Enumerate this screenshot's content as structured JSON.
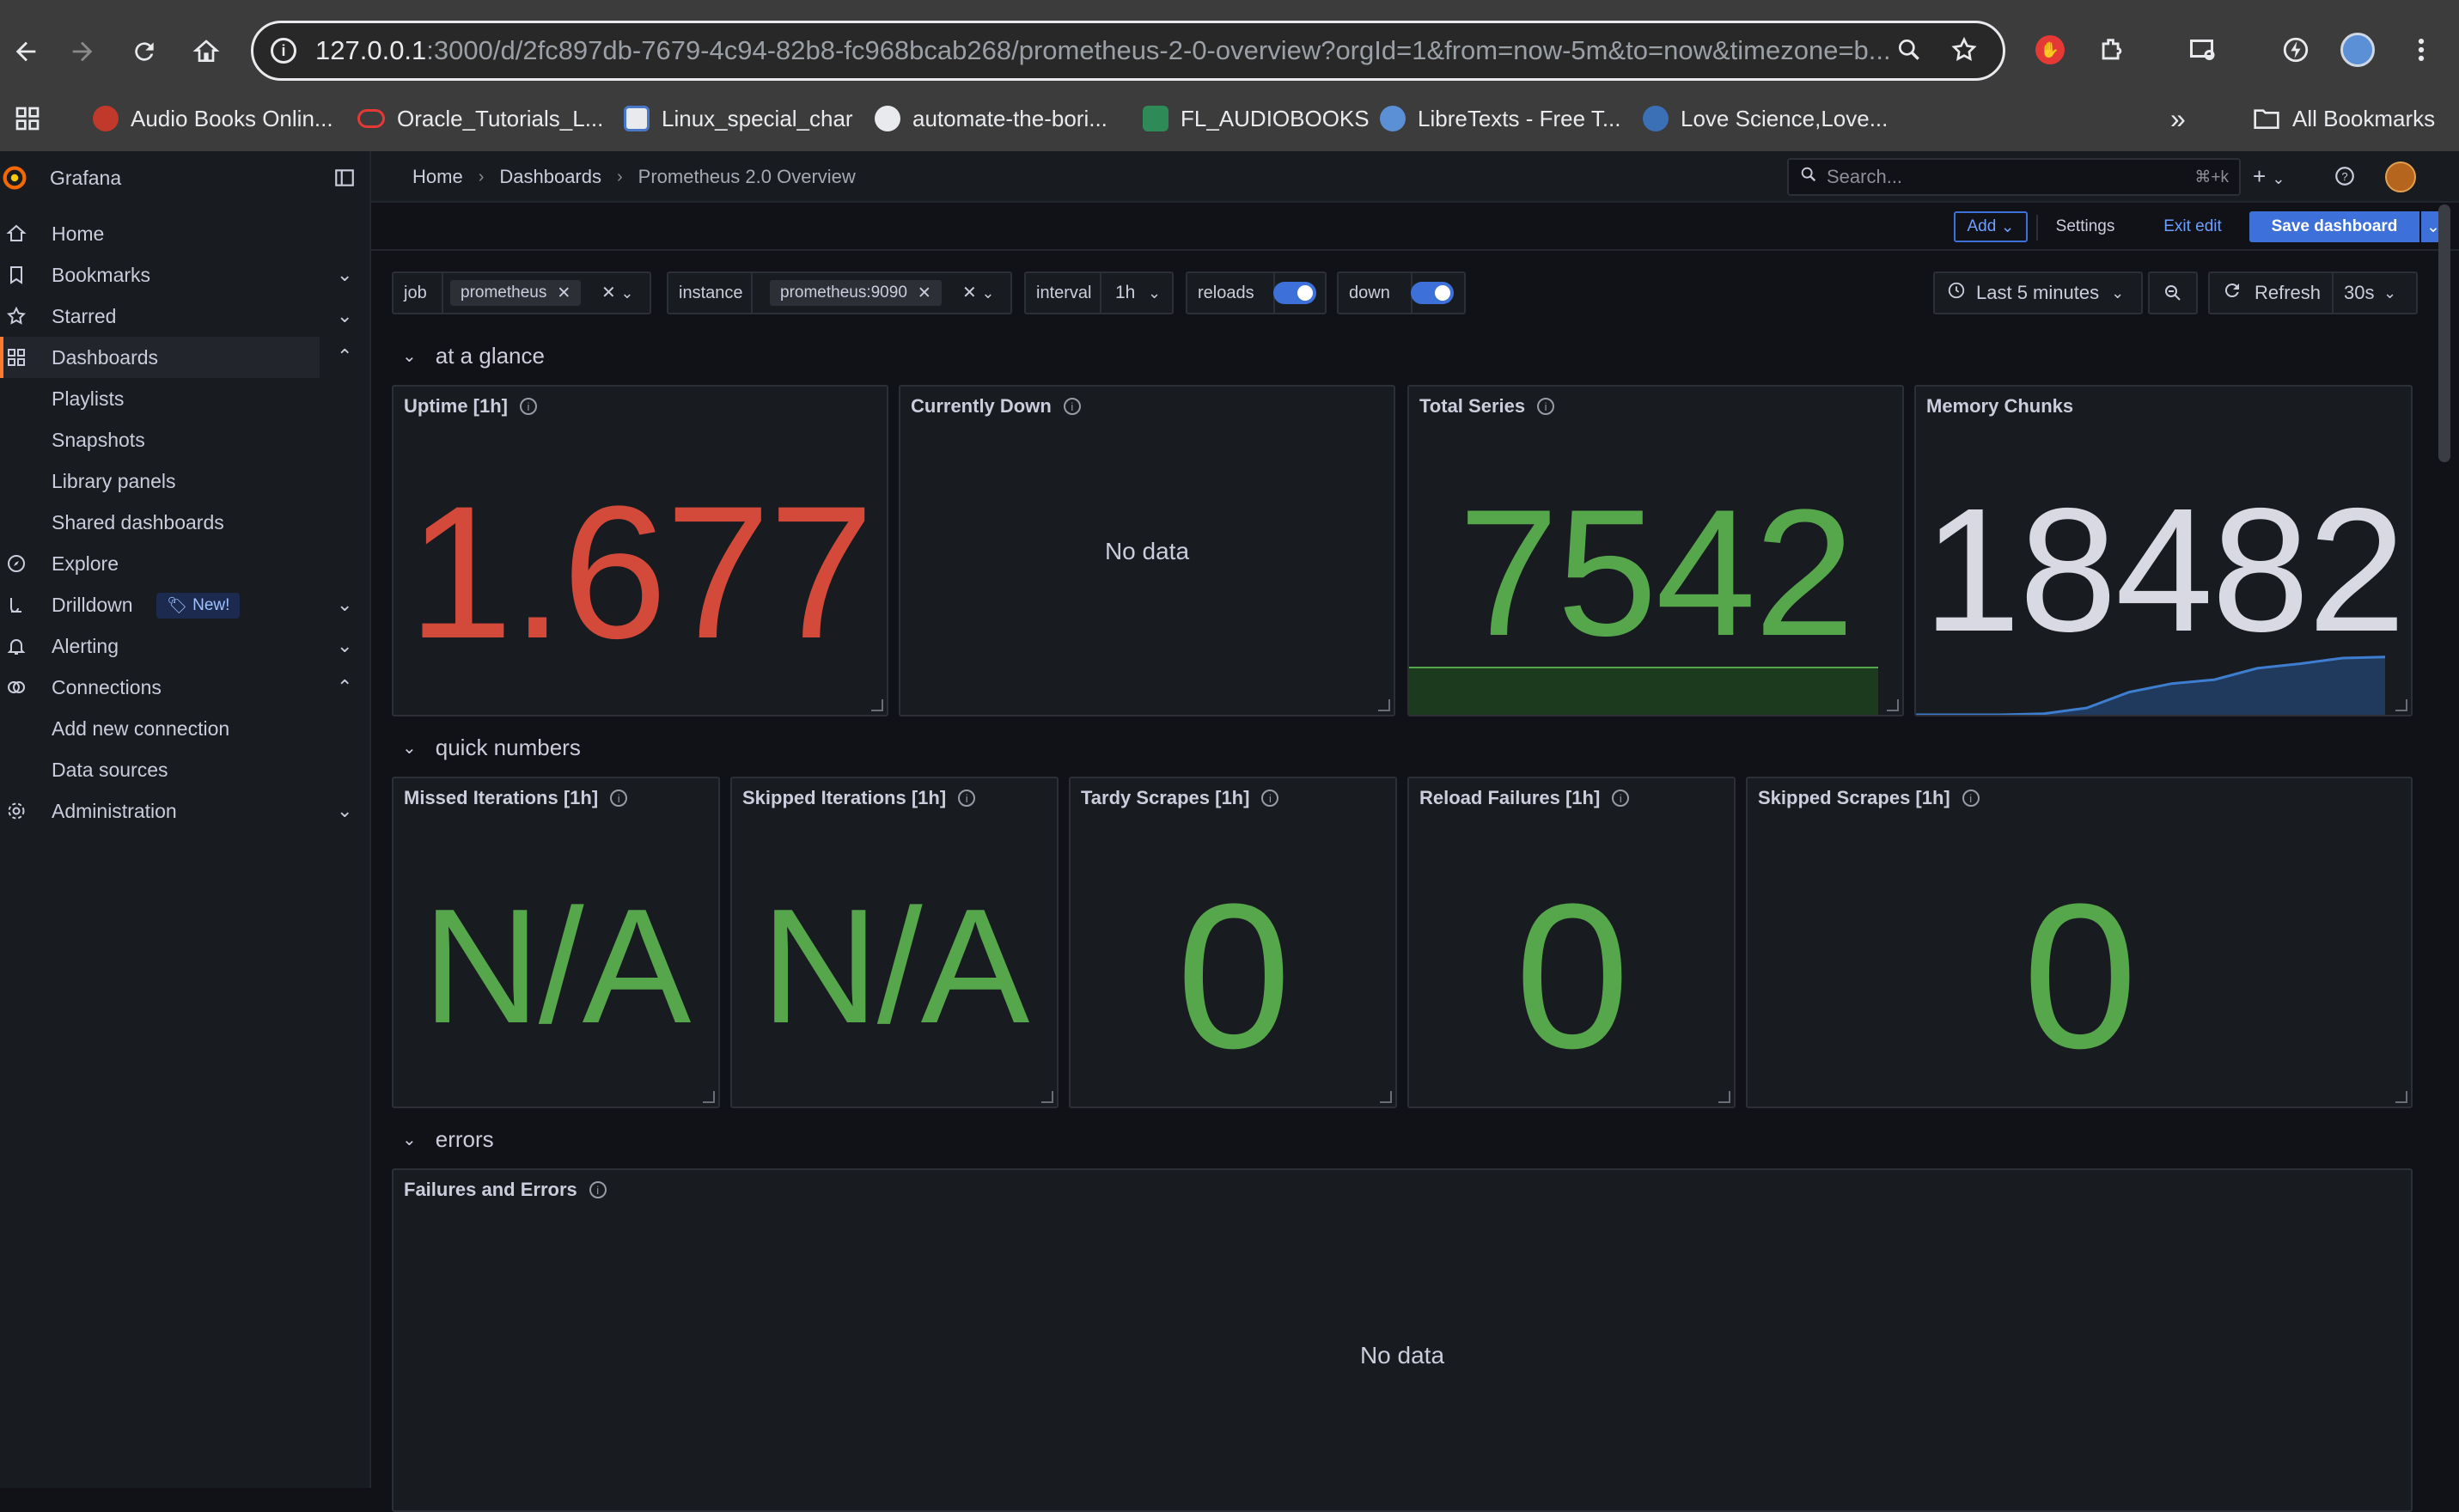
{
  "browser": {
    "url_host": "127.0.0.1",
    "url_rest": ":3000/d/2fc897db-7679-4c94-82b8-fc968bcab268/prometheus-2-0-overview?orgId=1&from=now-5m&to=now&timezone=b...",
    "bookmarks": [
      "Audio Books Onlin...",
      "Oracle_Tutorials_L...",
      "Linux_special_char",
      "automate-the-bori...",
      "FL_AUDIOBOOKS",
      "LibreTexts - Free T...",
      "Love Science,Love..."
    ],
    "all_bookmarks": "All Bookmarks",
    "more": "»"
  },
  "app": {
    "name": "Grafana",
    "breadcrumbs": [
      "Home",
      "Dashboards",
      "Prometheus 2.0 Overview"
    ],
    "search_placeholder": "Search...",
    "search_shortcut": "⌘+k"
  },
  "sidebar": {
    "items": [
      {
        "label": "Home"
      },
      {
        "label": "Bookmarks"
      },
      {
        "label": "Starred"
      },
      {
        "label": "Dashboards"
      },
      {
        "label": "Playlists"
      },
      {
        "label": "Snapshots"
      },
      {
        "label": "Library panels"
      },
      {
        "label": "Shared dashboards"
      },
      {
        "label": "Explore"
      },
      {
        "label": "Drilldown",
        "badge": "New!"
      },
      {
        "label": "Alerting"
      },
      {
        "label": "Connections"
      },
      {
        "label": "Add new connection"
      },
      {
        "label": "Data sources"
      },
      {
        "label": "Administration"
      }
    ]
  },
  "toolbar": {
    "add": "Add",
    "settings": "Settings",
    "exit_edit": "Exit edit",
    "save": "Save dashboard",
    "time_range": "Last 5 minutes",
    "refresh": "Refresh",
    "refresh_interval": "30s"
  },
  "variables": {
    "job_label": "job",
    "job_value": "prometheus",
    "instance_label": "instance",
    "instance_value": "prometheus:9090",
    "interval_label": "interval",
    "interval_value": "1h",
    "reloads_label": "reloads",
    "down_label": "down"
  },
  "rows": {
    "glance": "at a glance",
    "quick": "quick numbers",
    "errors": "errors"
  },
  "panels": {
    "uptime": {
      "title": "Uptime [1h]",
      "value": "1.677"
    },
    "currently_down": {
      "title": "Currently Down",
      "value": "No data"
    },
    "total_series": {
      "title": "Total Series",
      "value": "7542"
    },
    "memory_chunks": {
      "title": "Memory Chunks",
      "value": "18482"
    },
    "missed": {
      "title": "Missed Iterations [1h]",
      "value": "N/A"
    },
    "skipped_iter": {
      "title": "Skipped Iterations [1h]",
      "value": "N/A"
    },
    "tardy": {
      "title": "Tardy Scrapes [1h]",
      "value": "0"
    },
    "reload_fail": {
      "title": "Reload Failures [1h]",
      "value": "0"
    },
    "skipped_scrapes": {
      "title": "Skipped Scrapes [1h]",
      "value": "0"
    },
    "failures": {
      "title": "Failures and Errors",
      "value": "No data"
    }
  },
  "colors": {
    "red": "#d44a3a",
    "green": "#56a64b",
    "grey": "#d8d9e3",
    "accent": "#3d71d9"
  },
  "sparkline_memory": [
    0.0,
    0.0,
    0.0,
    0.02,
    0.12,
    0.4,
    0.55,
    0.62,
    0.82,
    0.9,
    1.0,
    1.02
  ]
}
